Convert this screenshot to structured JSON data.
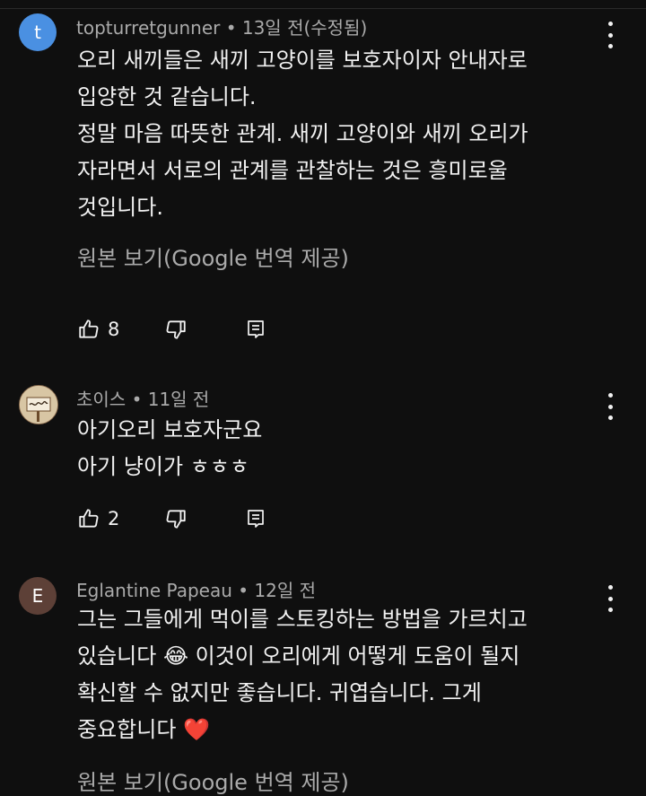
{
  "comments": [
    {
      "avatar_letter": "t",
      "avatar_color": "#4a90e2",
      "author": "topturretgunner",
      "time": "13일 전(수정됨)",
      "lines": [
        "오리 새끼들은 새끼 고양이를 보호자이자 안내자로",
        "입양한 것 같습니다.",
        "정말 마음 따뜻한 관계. 새끼 고양이와 새끼 오리가",
        "자라면서 서로의 관계를 관찰하는 것은 흥미로울",
        "것입니다."
      ],
      "translate_link": "원본 보기(Google 번역 제공)",
      "likes": "8"
    },
    {
      "avatar_letter": "",
      "avatar_color": "#e9dcc3",
      "author": "초이스",
      "time": "11일 전",
      "lines": [
        "아기오리 보호자군요",
        "아기 냥이가 ㅎㅎㅎ"
      ],
      "likes": "2"
    },
    {
      "avatar_letter": "E",
      "avatar_color": "#5d4037",
      "author": "Eglantine Papeau",
      "time": "12일 전",
      "lines": [
        "그는 그들에게 먹이를 스토킹하는 방법을 가르치고",
        "있습니다 😂 이것이 오리에게 어떻게 도움이 될지",
        "확신할 수 없지만 좋습니다. 귀엽습니다. 그게",
        "중요합니다 ❤️"
      ],
      "translate_link": "원본 보기(Google 번역 제공)"
    }
  ],
  "icons": {
    "like": "thumb-up-icon",
    "dislike": "thumb-down-icon",
    "reply": "reply-icon",
    "more": "more-vert-icon"
  }
}
